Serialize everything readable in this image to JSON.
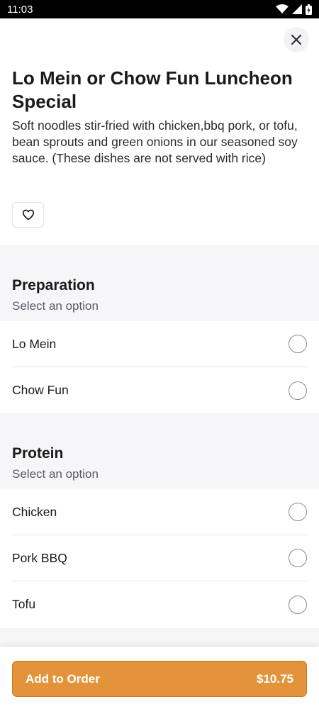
{
  "status_bar": {
    "time": "11:03"
  },
  "item": {
    "title": "Lo Mein or Chow Fun Luncheon Special",
    "description": "Soft noodles stir-fried with chicken,bbq pork, or tofu, bean sprouts and green onions in our seasoned soy sauce. (These dishes are not served with rice)"
  },
  "sections": [
    {
      "title": "Preparation",
      "subtitle": "Select an option",
      "options": [
        "Lo Mein",
        "Chow Fun"
      ]
    },
    {
      "title": "Protein",
      "subtitle": "Select an option",
      "options": [
        "Chicken",
        "Pork BBQ",
        "Tofu"
      ]
    }
  ],
  "footer": {
    "button_label": "Add to Order",
    "price": "$10.75"
  },
  "colors": {
    "accent": "#e3943a",
    "section_bg": "#f6f5f8"
  }
}
